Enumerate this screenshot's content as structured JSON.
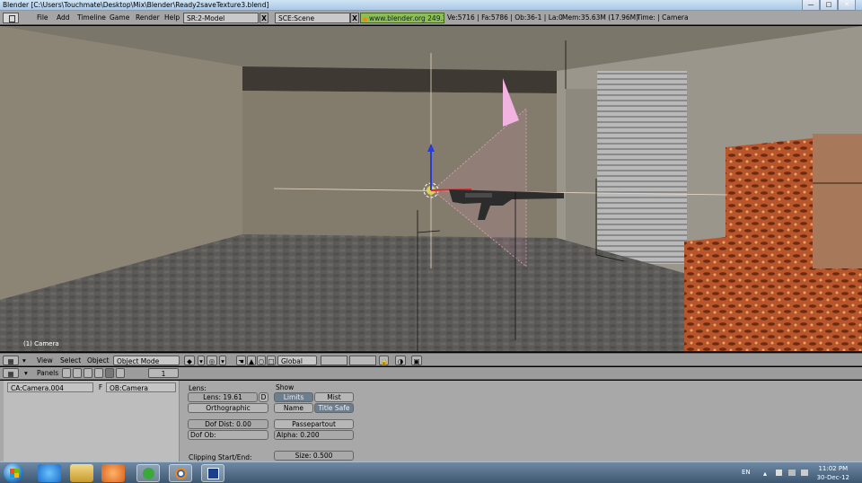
{
  "window": {
    "title": "Blender [C:\\Users\\Touchmate\\Desktop\\Mix\\Blender\\Ready2saveTexture3.blend]",
    "controls": {
      "minimize": "—",
      "maximize": "□",
      "close": "✕"
    }
  },
  "info_header": {
    "menus": [
      "File",
      "Add",
      "Timeline",
      "Game",
      "Render",
      "Help"
    ],
    "screen": "SR:2-Model",
    "scene": "SCE:Scene",
    "close_glyph": "X",
    "url": "www.blender.org 249.2",
    "stats": "Ve:5716 | Fa:5786 | Ob:36-1 | La:0",
    "mem": "Mem:35.63M (17.96M)",
    "time": "Time: | Camera"
  },
  "viewport": {
    "label": "(1) Camera"
  },
  "view3d_header": {
    "menus": [
      "View",
      "Select",
      "Object"
    ],
    "mode": "Object Mode",
    "orientation": "Global"
  },
  "buttons_header": {
    "panels_label": "Panels",
    "frame": "1"
  },
  "camera_panel": {
    "ca_name": "CA:Camera.004",
    "f_flag": "F",
    "ob_name": "OB:Camera",
    "lens_label": "Lens:",
    "lens_value": "Lens: 19.61",
    "d_button": "D",
    "orthographic": "Orthographic",
    "dof_dist": "Dof Dist: 0.00",
    "dof_ob": "Dof Ob:",
    "clipping_label": "Clipping Start/End:",
    "show_label": "Show",
    "limits": "Limits",
    "mist": "Mist",
    "name": "Name",
    "title_safe": "Title Safe",
    "passepartout": "Passepartout",
    "alpha": "Alpha: 0.200",
    "size": "Size: 0.500"
  },
  "taskbar": {
    "language": "EN",
    "time": "11:02 PM",
    "date": "30-Dec-12"
  },
  "colors": {
    "url_green": "#8fbf52",
    "panel_gray": "#a8a8a8",
    "taskbar": "#3e5770"
  }
}
